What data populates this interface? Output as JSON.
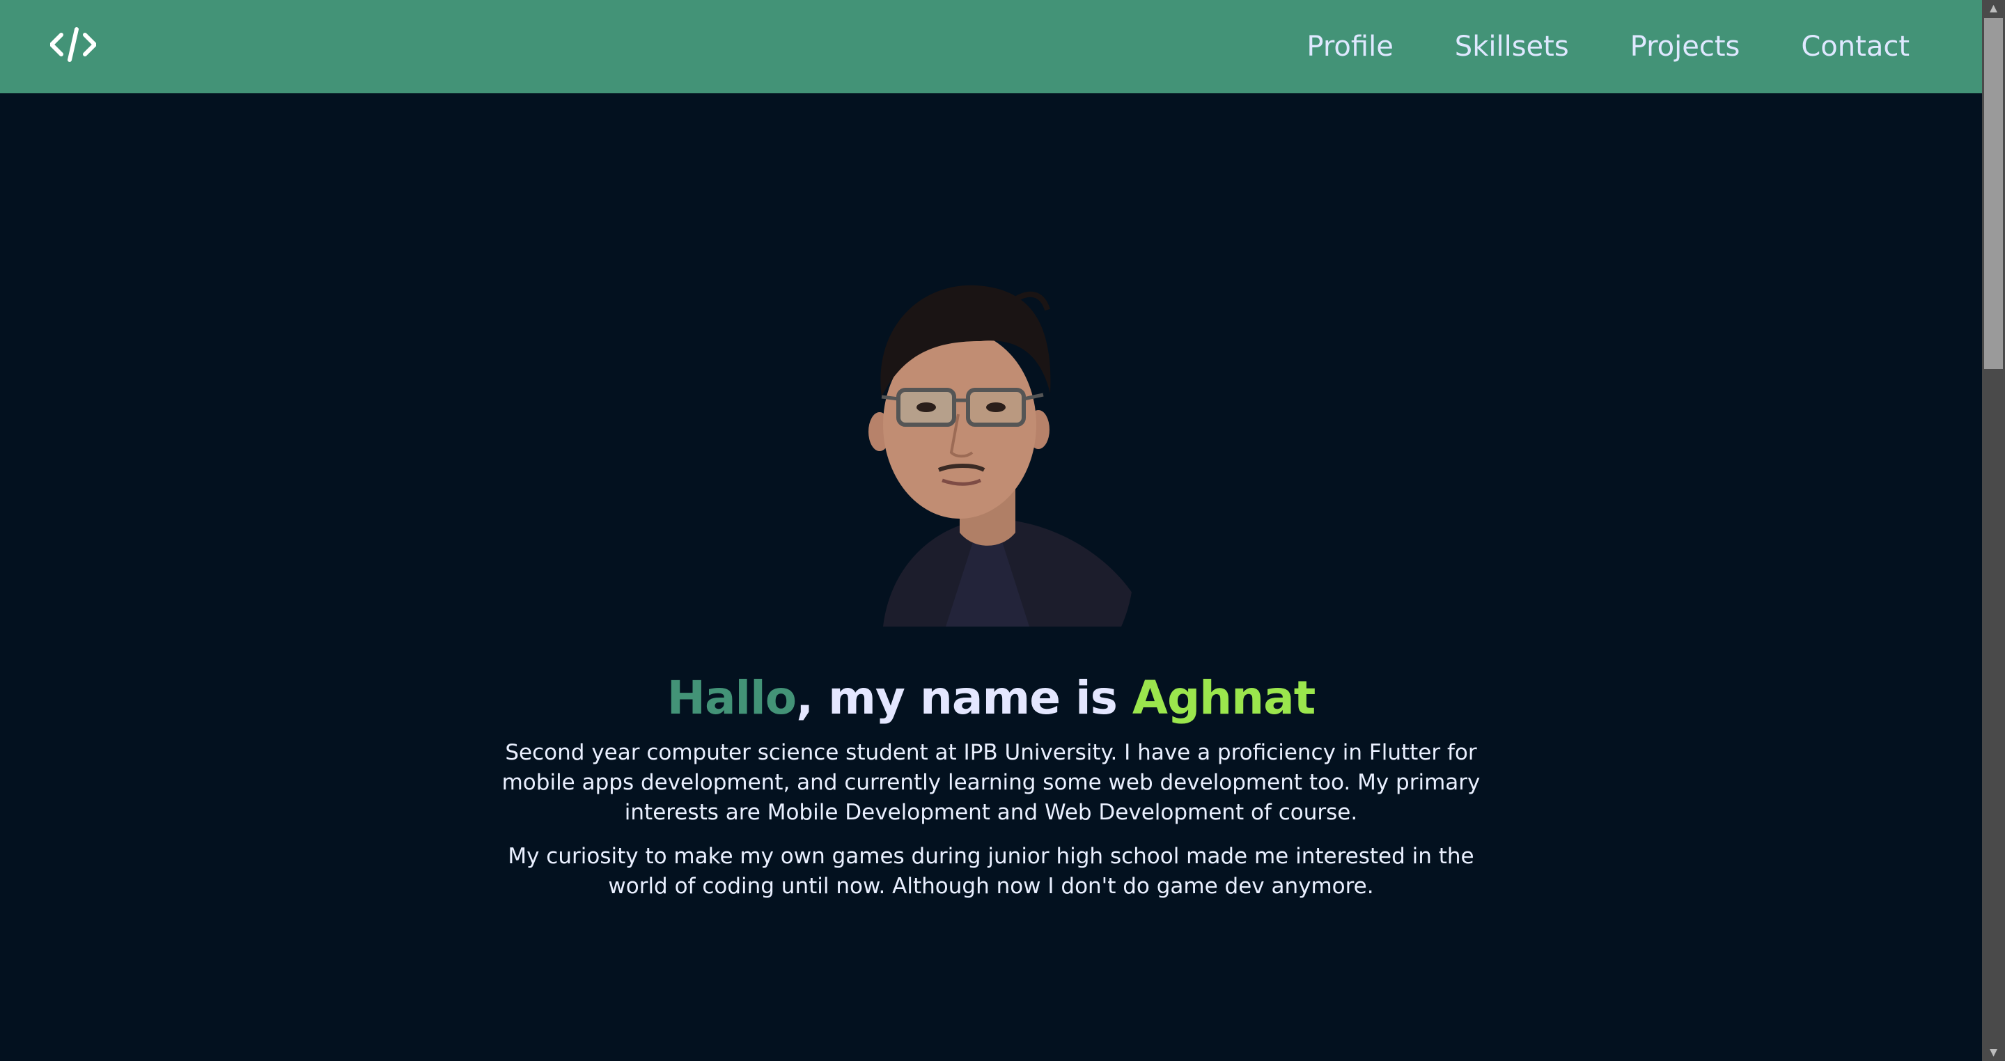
{
  "navbar": {
    "logo_icon": "code-brackets-icon",
    "links": [
      "Profile",
      "Skillsets",
      "Projects",
      "Contact"
    ]
  },
  "hero": {
    "greeting": "Hallo",
    "middle": ", my name is ",
    "name": "Aghnat",
    "bio_paragraph_1": "Second year computer science student at IPB University. I have a proficiency in Flutter for mobile apps development, and currently learning some web development too. My primary interests are Mobile Development and Web Development of course.",
    "bio_paragraph_2": "My curiosity to make my own games during junior high school made me interested in the world of coding until now. Although now I don't do game dev anymore."
  },
  "colors": {
    "navbar_bg": "#439377",
    "page_bg": "#03111f",
    "greeting_color": "#439377",
    "name_color": "#9be64d",
    "text_color": "#eaf0ff"
  },
  "icons": {
    "scroll_up": "scroll-up-arrow-icon",
    "scroll_down": "scroll-down-arrow-icon"
  }
}
